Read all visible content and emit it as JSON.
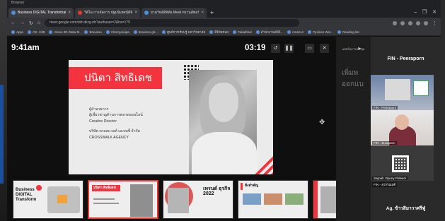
{
  "browser": {
    "window_title": "Browser",
    "tabs": [
      {
        "label": "Business DIGITAL Transformation Cha",
        "active": true
      },
      {
        "label": "วิดีโอ การจัดการ ปฐมนิเทศน์ดิจิทัล",
        "active": false
      },
      {
        "label": "ยามวิทย์ดิจิทัล Meet ทรานส์ฟอร์มดิจิทัล",
        "active": false
      }
    ],
    "url": "meet.google.com/xbf-dkzg-irb?authuser=2&hs=179",
    "bookmarks": [
      "Apps",
      "CE. Cdtt",
      "Vision 3D Raka M.",
      "Bravisso",
      "Cherryaraipa",
      "Bravisso gb...",
      "ศูนย์การเรียนรู้ มหาวิทยาลัย",
      "ดิจิทัลซ่อส",
      "Pakalbhal",
      "สำนักงานสถิติ...",
      "Amazon",
      "Pjolinee Wor...",
      "Reading list"
    ]
  },
  "meeting": {
    "clock": "9:41am",
    "timer": "03:19"
  },
  "slide": {
    "name_title": "ปนิตา สิทธิเดช",
    "role_lines": [
      "ผู้อำนวยการ",
      "ผู้เชี่ยวชาญด้านการตลาดออนไลน์",
      "Creative Director"
    ],
    "company_lines": [
      "บริษัท ครอสแวลค์ เอเจนซี่ จำกัด",
      "CROSSWALK AGENCY"
    ]
  },
  "thumbnails": [
    {
      "title": "Business DIGITAL Transform"
    },
    {
      "title": "ปนิตา สิทธิเดช"
    },
    {
      "title": "เทรนด์ ธุรกิจ 2022"
    },
    {
      "title": "สิ่งสำคัญ"
    },
    {
      "title": ""
    }
  ],
  "chat": {
    "header": "แชทในการประชุม",
    "preview": [
      "เพิ่มพ",
      "ออกแบ"
    ]
  },
  "participants": {
    "presenter": "FIN - Peeraporn",
    "tiles": [
      {
        "label": "FIN - Peeraporn"
      },
      {
        "label": "FIN - Suvaporn"
      },
      {
        "label": "Swipah Vipuny Peleers"
      },
      {
        "label": "FIN - สุวรรณฤดี"
      }
    ],
    "last_name": "Ag. ข้าวสิมาวาศรีฟู่"
  },
  "colors": {
    "accent_red": "#f3333d",
    "chrome_dark": "#202124"
  }
}
